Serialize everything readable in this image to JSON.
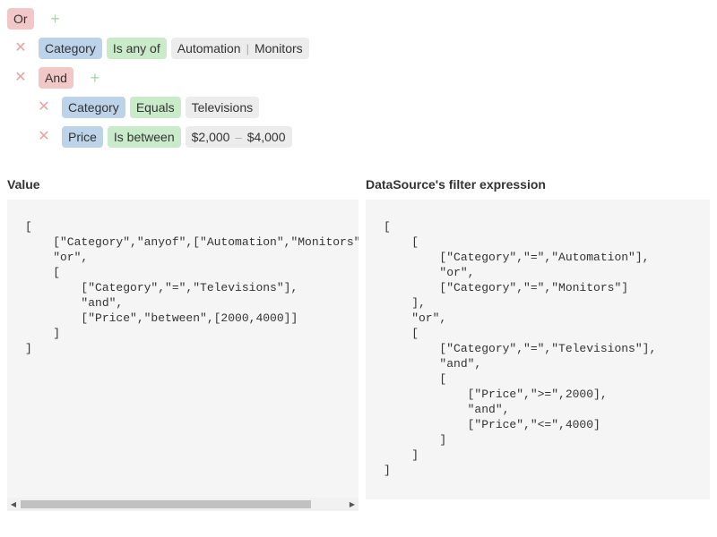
{
  "filter_builder": {
    "root_group": {
      "operator": "Or",
      "add_symbol": "+"
    },
    "conditions": [
      {
        "field": "Category",
        "operation": "Is any of",
        "values": [
          "Automation",
          "Monitors"
        ],
        "value_separator": "|"
      }
    ],
    "nested_group": {
      "operator": "And",
      "add_symbol": "+",
      "conditions": [
        {
          "field": "Category",
          "operation": "Equals",
          "value": "Televisions"
        },
        {
          "field": "Price",
          "operation": "Is between",
          "value_from": "$2,000",
          "range_separator": "–",
          "value_to": "$4,000"
        }
      ]
    },
    "remove_symbol": "✕"
  },
  "value_panel": {
    "title": "Value",
    "code": "[\n    [\"Category\",\"anyof\",[\"Automation\",\"Monitors\"]],\n    \"or\",\n    [\n        [\"Category\",\"=\",\"Televisions\"],\n        \"and\",\n        [\"Price\",\"between\",[2000,4000]]\n    ]\n]",
    "scroll_left_symbol": "◀",
    "scroll_right_symbol": "▶"
  },
  "expression_panel": {
    "title": "DataSource's filter expression",
    "code": "[\n    [\n        [\"Category\",\"=\",\"Automation\"],\n        \"or\",\n        [\"Category\",\"=\",\"Monitors\"]\n    ],\n    \"or\",\n    [\n        [\"Category\",\"=\",\"Televisions\"],\n        \"and\",\n        [\n            [\"Price\",\">=\",2000],\n            \"and\",\n            [\"Price\",\"<=\",4000]\n        ]\n    ]\n]"
  },
  "colors": {
    "group_chip": "#f2c7c7",
    "field_chip": "#bcd3ea",
    "operation_chip": "#c9ebc9",
    "value_chip": "#ececec",
    "remove_icon": "#e8a3a3",
    "add_icon": "#a6d8a6",
    "code_background": "#f5f5f5"
  },
  "icons": {
    "remove": "close-icon",
    "add": "plus-icon",
    "scroll_left": "triangle-left-icon",
    "scroll_right": "triangle-right-icon"
  }
}
